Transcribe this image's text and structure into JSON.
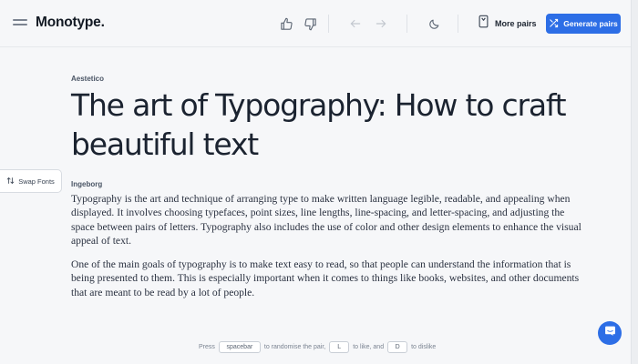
{
  "header": {
    "logo": "Monotype.",
    "more_pairs_label": "More pairs",
    "generate_label": "Generate pairs"
  },
  "content": {
    "heading_font_label": "Aestetico",
    "heading": "The art of Typography: How to craft beautiful text",
    "body_font_label": "Ingeborg",
    "paragraphs": [
      "Typography is the art and technique of arranging type to make written language legible, readable, and appealing when displayed. It involves choosing typefaces, point sizes, line lengths, line-spacing, and letter-spacing, and adjusting the space between pairs of letters. Typography also includes the use of color and other design elements to enhance the visual appeal of text.",
      "One of the main goals of typography is to make text easy to read, so that people can understand the information that is being presented to them. This is especially important when it comes to things like books, websites, and other documents that are meant to be read by a lot of people."
    ]
  },
  "swap_fonts_label": "Swap Fonts",
  "hint": {
    "press": "Press",
    "key_randomise": "spacebar",
    "to_randomise": "to randomise the pair,",
    "key_like": "L",
    "to_like": "to like, and",
    "key_dislike": "D",
    "to_dislike": "to dislike"
  },
  "icons": {
    "menu": "menu-icon",
    "like": "thumbs-up-icon",
    "dislike": "thumbs-down-icon",
    "back": "arrow-left-icon",
    "forward": "arrow-right-icon",
    "theme": "moon-icon",
    "more_pairs": "bookmark-icon",
    "generate": "shuffle-icon",
    "swap": "swap-arrows-icon",
    "chat": "chat-icon"
  },
  "colors": {
    "accent": "#2d6ee6",
    "background": "#f6f7f9"
  }
}
